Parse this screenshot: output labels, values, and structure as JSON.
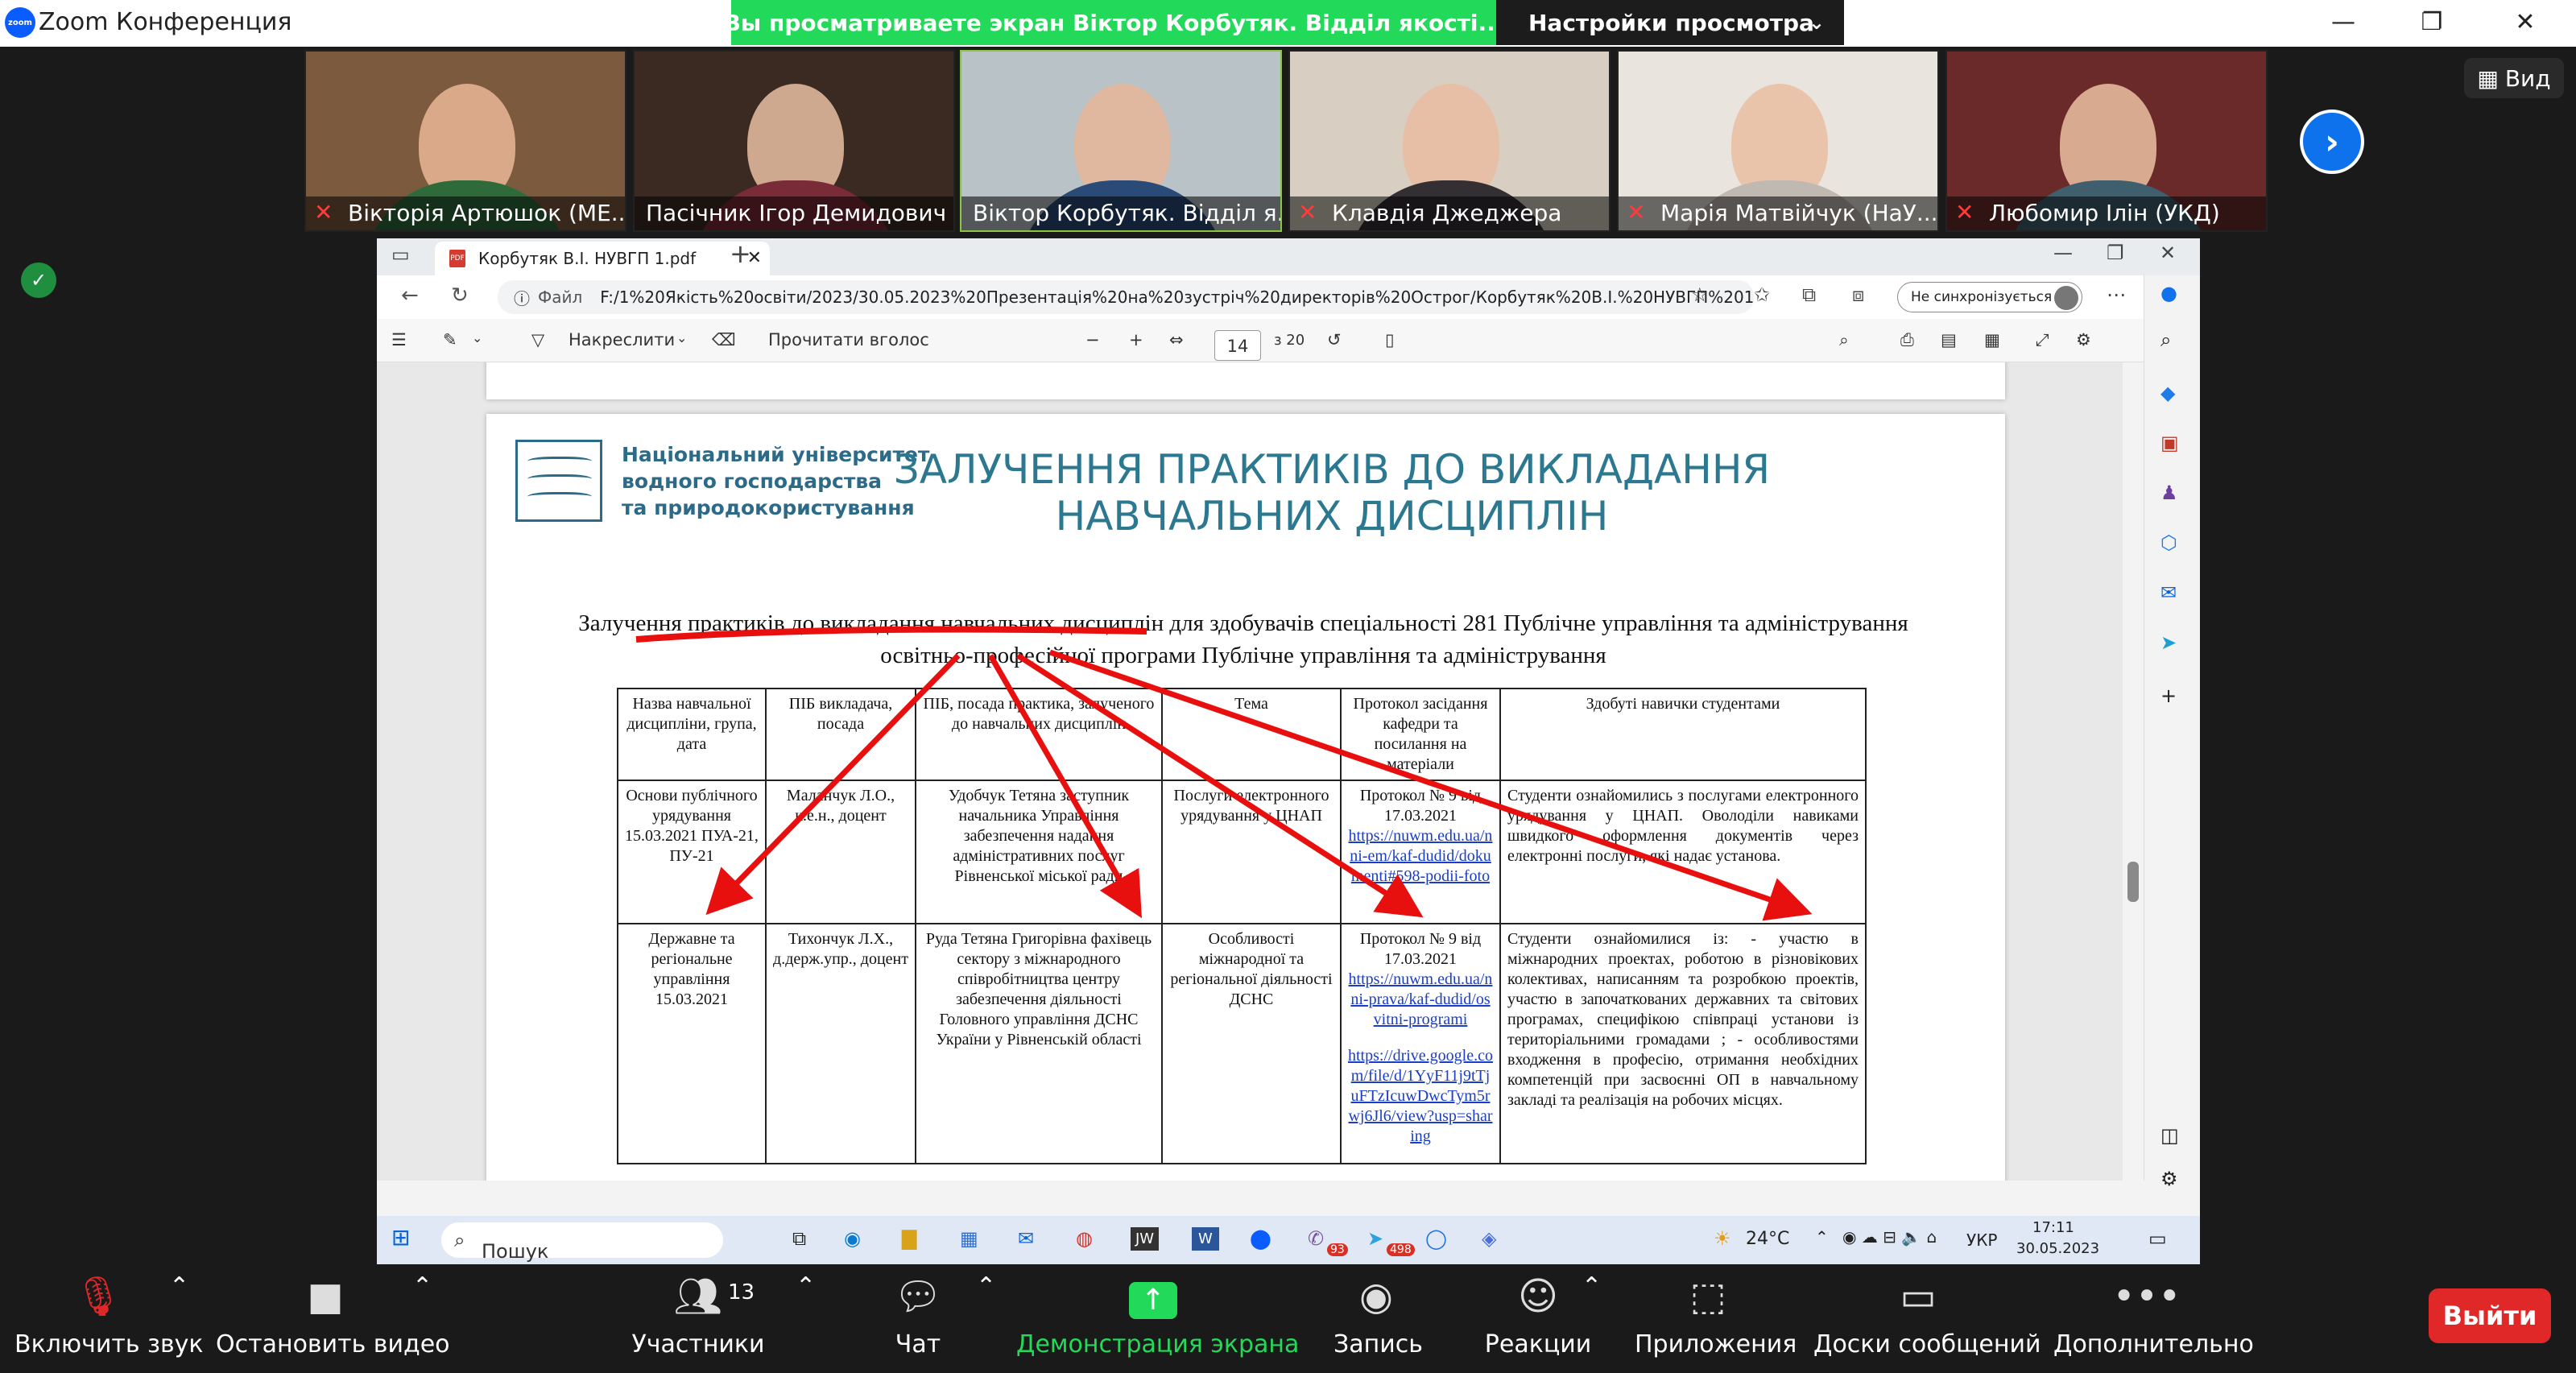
{
  "window": {
    "title": "Zoom Конференция",
    "logo": "zoom"
  },
  "banner": {
    "sharing_text": "Вы просматриваете экран Віктор Корбутяк. Відділ якості...",
    "view_settings": "Настройки просмотра"
  },
  "participants": [
    {
      "name": "Вікторія Артюшок (МЕ...",
      "muted": true
    },
    {
      "name": "Пасічник Ігор Демидович",
      "muted": false
    },
    {
      "name": "Віктор Корбутяк. Відділ я...",
      "muted": false
    },
    {
      "name": "Клавдія Джеджера",
      "muted": true
    },
    {
      "name": "Марія Матвійчук (НаУ...",
      "muted": true
    },
    {
      "name": "Любомир Ілін (УКД)",
      "muted": true
    }
  ],
  "view_button": "Вид",
  "browser": {
    "tab_title": "Корбутяк В.І. НУВГП 1.pdf",
    "url_prefix": "Файл",
    "url": "F:/1%20Якість%20освіти/2023/30.05.2023%20Презентація%20на%20зустріч%20директорів%20Острог/Корбутяк%20В.І.%20НУВГП%201.pdf",
    "sync": "Не синхронізується",
    "toolbar": {
      "draw": "Накреслити",
      "read_aloud": "Прочитати вголос",
      "page": "14",
      "of_pages": "з 20"
    }
  },
  "slide": {
    "university_lines": [
      "Національний університет",
      "водного господарства",
      "та природокористування"
    ],
    "title_lines": [
      "ЗАЛУЧЕННЯ ПРАКТИКІВ ДО ВИКЛАДАННЯ",
      "НАВЧАЛЬНИХ ДИСЦИПЛІН"
    ],
    "subtitle": "Залучення практиків до викладання навчальних дисциплін для здобувачів спеціальності 281 Публічне управління та адміністрування освітньо-професійної програми Публічне управління та адміністрування",
    "table": {
      "headers": [
        "Назва навчальної дисципліни, група, дата",
        "ПІБ викладача, посада",
        "ПІБ, посада практика, залученого до навчальних дисциплін",
        "Тема",
        "Протокол засідання кафедри та посилання на матеріали",
        "Здобуті навички студентами"
      ],
      "rows": [
        [
          "Основи публічного урядування 15.03.2021 ПУА-21, ПУ-21",
          "Маланчук Л.О., к.е.н., доцент",
          "Удобчук Тетяна заступник начальника Управління забезпечення надання адміністративних послуг Рівненської міської ради",
          "Послуги електронного урядування у ЦНАП",
          "Протокол № 9 від 17.03.2021",
          "Студенти ознайомились з послугами електронного урядування у ЦНАП. Оволоділи навиками швидкого оформлення документів через електронні послуги, які надає установа."
        ],
        [
          "Державне та регіональне управління 15.03.2021",
          "Тихончук Л.Х., д.держ.упр., доцент",
          "Руда Тетяна Григорівна фахівець сектору з міжнародного співробітництва центру забезпечення діяльності Головного управління ДСНС України у Рівненській області",
          "Особливості міжнародної та регіональної діяльності ДСНС",
          "Протокол № 9 від 17.03.2021",
          "Студенти ознайомилися із: - участю в міжнародних проектах, роботою в різновікових колективах, написанням та розробкою проектів, участю в започаткованих державних та світових програмах, специфікою співпраці установи із територіальними громадами ; - особливостями входження в професію, отримання необхідних компетенцій при засвоєнні ОП в навчальному закладі та реалізація на робочих місцях."
        ]
      ],
      "links_row1": [
        "https://nuwm.edu.ua/nni-em/kaf-dudid/dokumenti#598-podii-foto"
      ],
      "links_row2": [
        "https://nuwm.edu.ua/nni-prava/kaf-dudid/osvitni-programi",
        "https://drive.google.com/file/d/1YyF11j9tTjuFTzIcuwDwcTym5rwj6Jl6/view?usp=sharing"
      ]
    }
  },
  "taskbar": {
    "search": "Пошук",
    "weather": "24°C",
    "lang": "УКР",
    "time": "17:11",
    "date": "30.05.2023",
    "badge1": "93",
    "badge2": "498"
  },
  "bottom": {
    "mute": "Включить звук",
    "video": "Остановить видео",
    "participants": "Участники",
    "participants_count": "13",
    "chat": "Чат",
    "share": "Демонстрация экрана",
    "record": "Запись",
    "reactions": "Реакции",
    "apps": "Приложения",
    "whiteboards": "Доски сообщений",
    "more": "Дополнительно",
    "leave": "Выйти"
  },
  "colors": {
    "share_green": "#23d959",
    "zoom_blue": "#0e72ed",
    "leave_red": "#e02828",
    "arrow_red": "#e8100f"
  }
}
